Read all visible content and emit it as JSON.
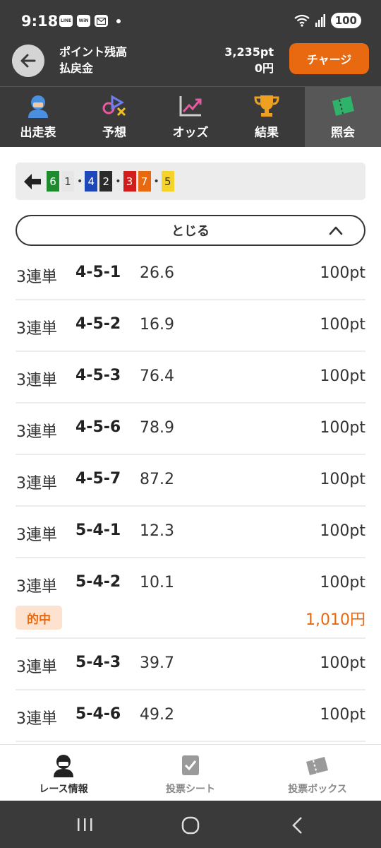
{
  "status": {
    "time": "9:18",
    "battery": "100",
    "app_icons": [
      "LINE",
      "WiN",
      "mail"
    ]
  },
  "header": {
    "points_label": "ポイント残高",
    "payout_label": "払戻金",
    "points_value": "3,235pt",
    "payout_value": "0円",
    "charge_label": "チャージ"
  },
  "tabs": [
    {
      "label": "出走表",
      "icon": "racer-icon"
    },
    {
      "label": "予想",
      "icon": "prediction-icon"
    },
    {
      "label": "オッズ",
      "icon": "chart-icon"
    },
    {
      "label": "結果",
      "icon": "trophy-icon"
    },
    {
      "label": "照会",
      "icon": "ticket-icon",
      "active": true
    }
  ],
  "combo_bar": {
    "numbers": [
      {
        "n": "6",
        "bg": "#1e8c2e",
        "fg": "#ffffff"
      },
      {
        "n": "1",
        "bg": "#e6e6e6",
        "fg": "#333333"
      },
      {
        "n": "4",
        "bg": "#1f47b8",
        "fg": "#ffffff"
      },
      {
        "n": "2",
        "bg": "#2b2b2b",
        "fg": "#ffffff"
      },
      {
        "n": "3",
        "bg": "#d21d1d",
        "fg": "#ffffff"
      },
      {
        "n": "7",
        "bg": "#e8690f",
        "fg": "#ffffff"
      },
      {
        "n": "5",
        "bg": "#f5d22c",
        "fg": "#333333"
      }
    ],
    "separator": "•"
  },
  "close_button": {
    "label": "とじる"
  },
  "bets": [
    {
      "type": "3連単",
      "combo": "4-5-1",
      "odds": "26.6",
      "stake": "100pt"
    },
    {
      "type": "3連単",
      "combo": "4-5-2",
      "odds": "16.9",
      "stake": "100pt"
    },
    {
      "type": "3連単",
      "combo": "4-5-3",
      "odds": "76.4",
      "stake": "100pt"
    },
    {
      "type": "3連単",
      "combo": "4-5-6",
      "odds": "78.9",
      "stake": "100pt"
    },
    {
      "type": "3連単",
      "combo": "4-5-7",
      "odds": "87.2",
      "stake": "100pt"
    },
    {
      "type": "3連単",
      "combo": "5-4-1",
      "odds": "12.3",
      "stake": "100pt"
    },
    {
      "type": "3連単",
      "combo": "5-4-2",
      "odds": "10.1",
      "stake": "100pt",
      "hit": "的中",
      "payout": "1,010円"
    },
    {
      "type": "3連単",
      "combo": "5-4-3",
      "odds": "39.7",
      "stake": "100pt"
    },
    {
      "type": "3連単",
      "combo": "5-4-6",
      "odds": "49.2",
      "stake": "100pt"
    }
  ],
  "bottom_nav": [
    {
      "label": "レース情報",
      "icon": "racer-icon",
      "active": true
    },
    {
      "label": "投票シート",
      "icon": "vote-sheet-icon"
    },
    {
      "label": "投票ボックス",
      "icon": "ticket-box-icon"
    }
  ],
  "colors": {
    "accent": "#e8690f",
    "header_bg": "#3a3a3a",
    "hit_bg": "#fde2cf"
  }
}
